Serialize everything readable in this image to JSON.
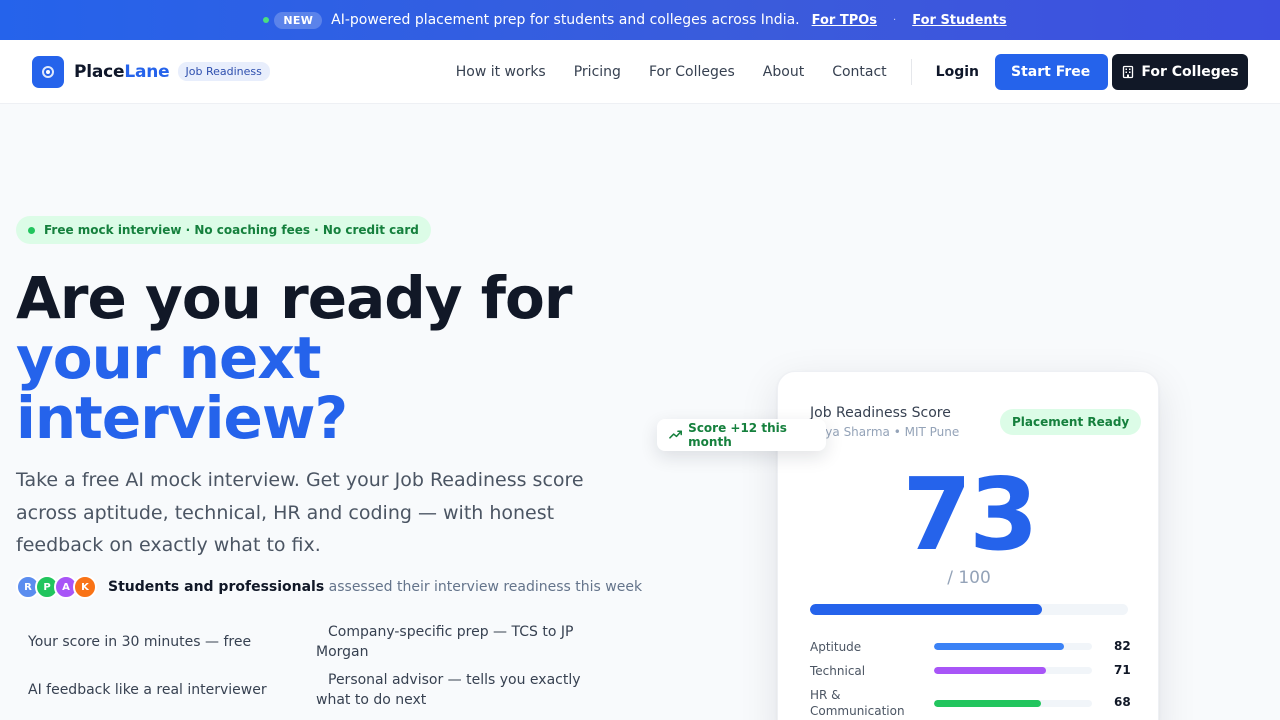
{
  "announcement": {
    "badge": "NEW",
    "message": "AI-powered placement prep for students and colleges across India.",
    "link_tpos": "For TPOs",
    "separator": "·",
    "link_students": "For Students",
    "dot_color": "#4ade80"
  },
  "header": {
    "brand_part1": "Place",
    "brand_part2": "Lane",
    "brand_tag": "Job Readiness",
    "nav": [
      "How it works",
      "Pricing",
      "For Colleges",
      "About",
      "Contact"
    ],
    "login": "Login",
    "start_free": "Start Free",
    "for_colleges_btn": "For Colleges",
    "accent_color": "#2563eb"
  },
  "hero": {
    "badge": "Free mock interview · No coaching fees · No credit card",
    "headline_line1": "Are you ready for",
    "headline_line2": "your next",
    "headline_line3": "interview?",
    "subheading": "Take a free AI mock interview. Get your Job Readiness score across aptitude, technical, HR and coding — with honest feedback on exactly what to fix.",
    "avatars": [
      {
        "initial": "R",
        "color": "#5b8def"
      },
      {
        "initial": "P",
        "color": "#22c55e"
      },
      {
        "initial": "A",
        "color": "#a855f7"
      },
      {
        "initial": "K",
        "color": "#f97316"
      }
    ],
    "social_bold": "Students and professionals",
    "social_rest": "assessed their interview readiness this week",
    "features": [
      "Your score in 30 minutes — free",
      "Company-specific prep — TCS to JP Morgan",
      "AI feedback like a real interviewer",
      "Personal advisor — tells you exactly what to do next"
    ]
  },
  "score_card": {
    "title": "Job Readiness Score",
    "student": "Priya Sharma • MIT Pune",
    "status": "Placement Ready",
    "score": "73",
    "score_max": "/ 100",
    "score_fraction": 0.73,
    "metrics": [
      {
        "label": "Aptitude",
        "value": "82",
        "fraction": 0.82,
        "color": "#3b82f6"
      },
      {
        "label": "Technical",
        "value": "71",
        "fraction": 0.71,
        "color": "#a855f7"
      },
      {
        "label": "HR & Communication",
        "value": "68",
        "fraction": 0.68,
        "color": "#22c55e"
      }
    ]
  },
  "chip": {
    "text": "Score +12 this month",
    "icon": "trending-up-icon"
  }
}
